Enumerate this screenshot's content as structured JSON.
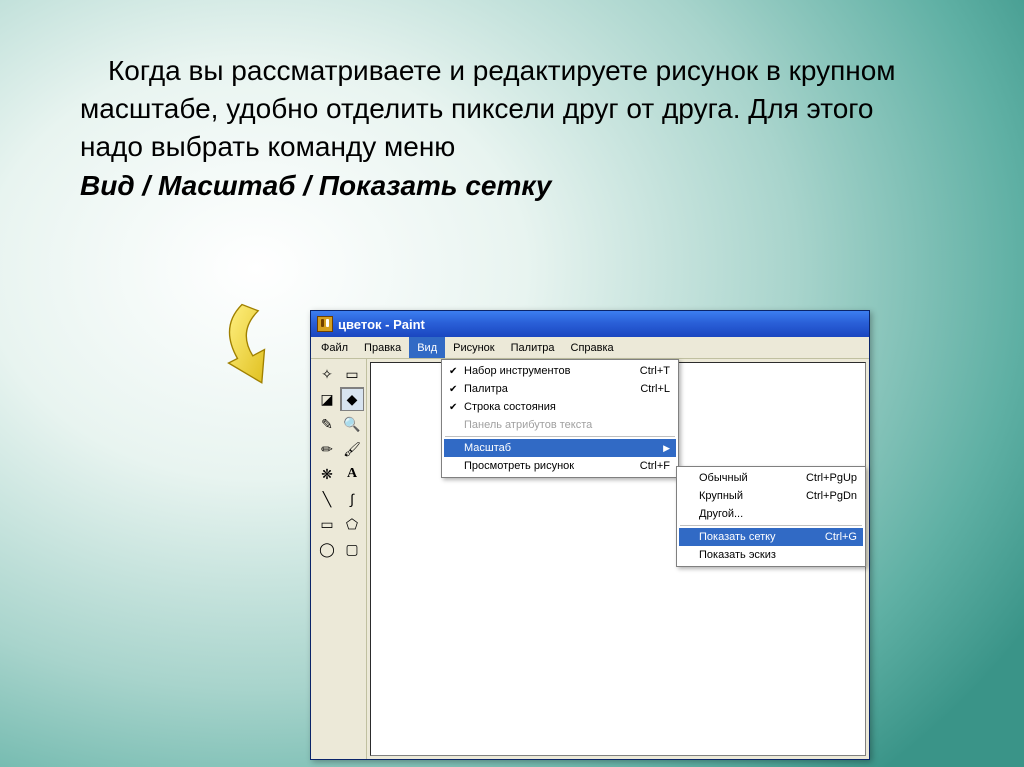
{
  "slide": {
    "para1": "Когда вы рассматриваете и редактируете рисунок в крупном масштабе, удобно отделить пиксели друг от друга. Для этого надо выбрать команду меню",
    "para2": "Вид / Масштаб / Показать сетку"
  },
  "window": {
    "title": "цветок - Paint"
  },
  "menu": {
    "items": [
      "Файл",
      "Правка",
      "Вид",
      "Рисунок",
      "Палитра",
      "Справка"
    ],
    "active": "Вид"
  },
  "dropdown": {
    "toolbox": {
      "label": "Набор инструментов",
      "shortcut": "Ctrl+T",
      "checked": true
    },
    "palette": {
      "label": "Палитра",
      "shortcut": "Ctrl+L",
      "checked": true
    },
    "statusbar": {
      "label": "Строка состояния",
      "checked": true
    },
    "textpanel": {
      "label": "Панель атрибутов текста"
    },
    "zoom": {
      "label": "Масштаб"
    },
    "viewbitmap": {
      "label": "Просмотреть рисунок",
      "shortcut": "Ctrl+F"
    }
  },
  "submenu": {
    "normal": {
      "label": "Обычный",
      "shortcut": "Ctrl+PgUp"
    },
    "large": {
      "label": "Крупный",
      "shortcut": "Ctrl+PgDn"
    },
    "custom": {
      "label": "Другой..."
    },
    "showgrid": {
      "label": "Показать сетку",
      "shortcut": "Ctrl+G"
    },
    "thumbnail": {
      "label": "Показать эскиз"
    }
  },
  "tools": {
    "freeselect": "✧",
    "rectselect": "▭",
    "eraser": "◪",
    "fill": "◆",
    "picker": "✎",
    "zoom": "🔍",
    "pencil": "✏",
    "brush": "🖌",
    "spray": "❋",
    "text": "A",
    "line": "╲",
    "curve": "∫",
    "rect": "▭",
    "poly": "⬠",
    "ellipse": "◯",
    "roundrect": "▢"
  }
}
